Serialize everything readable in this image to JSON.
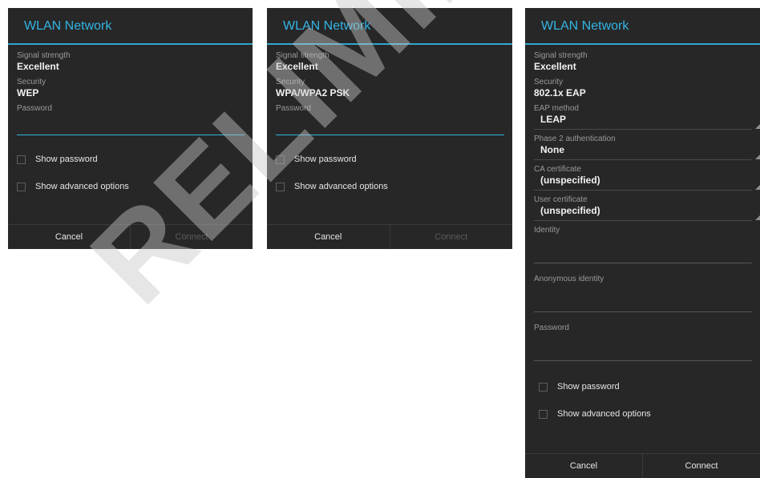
{
  "title": "WLAN Network",
  "labels": {
    "signal": "Signal strength",
    "security": "Security",
    "password": "Password",
    "eap_method": "EAP method",
    "phase2": "Phase 2 authentication",
    "ca_cert": "CA certificate",
    "user_cert": "User certificate",
    "identity": "Identity",
    "anon_identity": "Anonymous identity"
  },
  "show_password": "Show password",
  "show_advanced": "Show advanced options",
  "cancel": "Cancel",
  "connect": "Connect",
  "dialogs": [
    {
      "signal": "Excellent",
      "security": "WEP"
    },
    {
      "signal": "Excellent",
      "security": "WPA/WPA2 PSK"
    },
    {
      "signal": "Excellent",
      "security": "802.1x EAP",
      "eap_method": "LEAP",
      "phase2": "None",
      "ca_cert": "(unspecified)",
      "user_cert": "(unspecified)"
    }
  ],
  "watermark": "RELIMINARY",
  "colors": {
    "accent": "#33b5e5",
    "dialog_bg": "#272727"
  }
}
